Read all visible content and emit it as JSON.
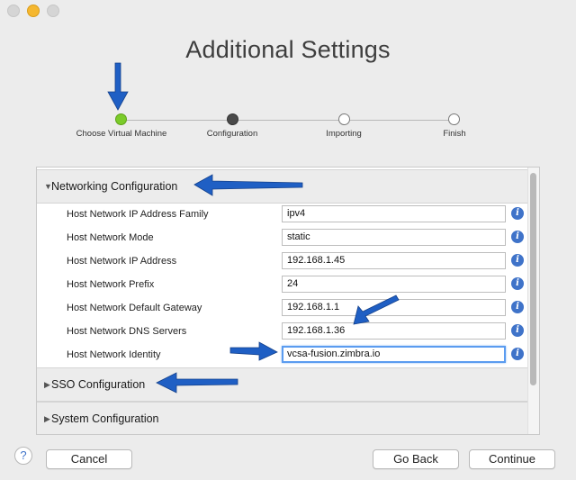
{
  "window": {
    "title": "Additional Settings"
  },
  "stepper": {
    "steps": [
      {
        "label": "Choose Virtual Machine",
        "state": "done"
      },
      {
        "label": "Configuration",
        "state": "current"
      },
      {
        "label": "Importing",
        "state": "pending"
      },
      {
        "label": "Finish",
        "state": "pending"
      }
    ]
  },
  "sections": {
    "networking": {
      "label": "Networking Configuration",
      "expanded": true,
      "rows": [
        {
          "label": "Host Network IP Address Family",
          "value": "ipv4"
        },
        {
          "label": "Host Network Mode",
          "value": "static"
        },
        {
          "label": "Host Network IP Address",
          "value": "192.168.1.45"
        },
        {
          "label": "Host Network Prefix",
          "value": "24"
        },
        {
          "label": "Host Network Default Gateway",
          "value": "192.168.1.1"
        },
        {
          "label": "Host Network DNS Servers",
          "value": "192.168.1.36"
        },
        {
          "label": "Host Network Identity",
          "value": "vcsa-fusion.zimbra.io"
        }
      ]
    },
    "sso": {
      "label": "SSO Configuration",
      "expanded": false
    },
    "system": {
      "label": "System Configuration",
      "expanded": false
    }
  },
  "icons": {
    "expanded": "▼",
    "collapsed": "▶",
    "info": "i",
    "help": "?"
  },
  "buttons": {
    "cancel": "Cancel",
    "go_back": "Go Back",
    "continue": "Continue"
  },
  "colors": {
    "step_done": "#7bcb2a",
    "step_current": "#4a4a4a",
    "info_icon": "#3f73c9",
    "focus_ring": "#5b9cf0",
    "annotation_arrow": "#1f5fc4"
  }
}
